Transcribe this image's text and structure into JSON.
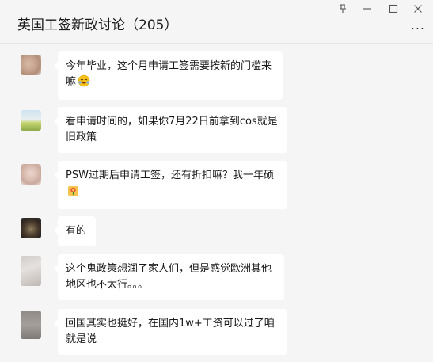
{
  "window": {
    "title": "英国工签新政讨论（205）",
    "more_label": "..."
  },
  "icons": {
    "pin": "pin-icon",
    "minimize": "minimize-icon",
    "maximize": "maximize-icon",
    "close": "close-icon",
    "more": "more-icon"
  },
  "messages": [
    {
      "text": "今年毕业，这个月申请工签需要按新的门槛来嘛",
      "emoji": "crying-laughing-emoji"
    },
    {
      "text": "看申请时间的，如果你7月22日前拿到cos就是旧政策"
    },
    {
      "text": "PSW过期后申请工签，还有折扣嘛？我一年硕",
      "emoji": "flower-emoji"
    },
    {
      "text": "有的"
    },
    {
      "text": "这个鬼政策想润了家人们，但是感觉欧洲其他地区也不太行。。。"
    },
    {
      "text": "回国其实也挺好，在国内1w+工资可以过了咱就是说"
    }
  ],
  "colors": {
    "background": "#f5f5f5",
    "bubble": "#ffffff",
    "text": "#1a1a1a"
  }
}
